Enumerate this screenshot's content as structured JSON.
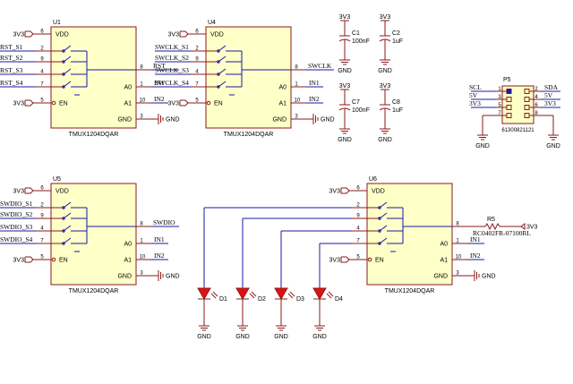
{
  "chips": [
    {
      "ref": "U1",
      "part": "TMUX1204DQAR",
      "supply": "3V3",
      "en": "3V3",
      "inputs": [
        "RST_S1",
        "RST_S2",
        "RST_S3",
        "RST_S4"
      ],
      "output": "RST",
      "a0": "IN1",
      "a1": "IN2",
      "gnd": "GND"
    },
    {
      "ref": "U4",
      "part": "TMUX1204DQAR",
      "supply": "3V3",
      "en": "3V3",
      "inputs": [
        "SWCLK_S1",
        "SWCLK_S2",
        "SWCLK_S3",
        "SWCLK_S4"
      ],
      "output": "SWCLK",
      "a0": "IN1",
      "a1": "IN2",
      "gnd": "GND"
    },
    {
      "ref": "U5",
      "part": "TMUX1204DQAR",
      "supply": "3V3",
      "en": "3V3",
      "inputs": [
        "SWDIO_S1",
        "SWDIO_S2",
        "SWDIO_S3",
        "SWDIO_S4"
      ],
      "output": "SWDIO",
      "a0": "IN1",
      "a1": "IN2",
      "gnd": "GND"
    },
    {
      "ref": "U6",
      "part": "TMUX1204DQAR",
      "supply": "3V3",
      "en": "3V3",
      "inputs": [
        "",
        "",
        "",
        ""
      ],
      "output": "",
      "a0": "IN1",
      "a1": "IN2",
      "gnd": "GND"
    }
  ],
  "pin_labels": {
    "vdd": "VDD",
    "en": "EN",
    "gnd": "GND",
    "a0": "A0",
    "a1": "A1"
  },
  "pin_numbers": {
    "vdd": "6",
    "s": [
      "2",
      "9",
      "4",
      "7"
    ],
    "d": "8",
    "en": "5",
    "a0": "1",
    "a1": "10",
    "gnd": "3"
  },
  "capacitors": [
    {
      "ref": "C1",
      "value": "100nF",
      "net": "3V3",
      "gnd": "GND"
    },
    {
      "ref": "C2",
      "value": "1uF",
      "net": "3V3",
      "gnd": "GND"
    },
    {
      "ref": "C7",
      "value": "100nF",
      "net": "3V3",
      "gnd": "GND"
    },
    {
      "ref": "C8",
      "value": "1uF",
      "net": "3V3",
      "gnd": "GND"
    }
  ],
  "connector": {
    "ref": "P5",
    "part": "61300821121",
    "left_nets": [
      "SCL",
      "5V",
      "3V3"
    ],
    "right_nets": [
      "SDA",
      "5V",
      "3V3"
    ],
    "left_pins": [
      "1",
      "3",
      "5",
      "7"
    ],
    "right_pins": [
      "2",
      "4",
      "6",
      "8"
    ],
    "gnd": "GND"
  },
  "leds": [
    {
      "ref": "D1",
      "gnd": "GND"
    },
    {
      "ref": "D2",
      "gnd": "GND"
    },
    {
      "ref": "D3",
      "gnd": "GND"
    },
    {
      "ref": "D4",
      "gnd": "GND"
    }
  ],
  "resistor": {
    "ref": "R5",
    "part": "RC0402FR-07100RL",
    "net": "3V3"
  },
  "colors": {
    "body": "#ffffc8",
    "pin": "#8b1a1a",
    "wire": "#1a1aa6",
    "led": "#e01010"
  }
}
